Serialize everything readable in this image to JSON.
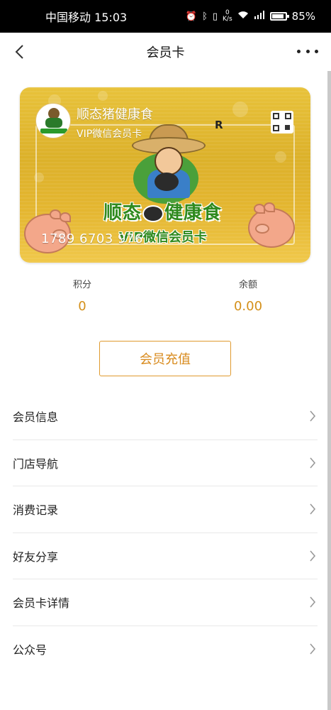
{
  "status_bar": {
    "carrier_time": "中国移动 15:03",
    "net_speed_top": "0",
    "net_speed_bottom": "K/s",
    "battery": "85%"
  },
  "nav": {
    "title": "会员卡"
  },
  "card": {
    "store_name": "顺态猪健康食",
    "card_type": "VIP微信会员卡",
    "r_mark": "R",
    "brand_left": "顺态",
    "brand_right": "健康食",
    "vip_label": "VIP微信会员卡",
    "card_number": "1789 6703 976"
  },
  "stats": {
    "points_label": "积分",
    "points_value": "0",
    "balance_label": "余额",
    "balance_value": "0.00"
  },
  "recharge_button": "会员充值",
  "menu": [
    {
      "label": "会员信息"
    },
    {
      "label": "门店导航"
    },
    {
      "label": "消费记录"
    },
    {
      "label": "好友分享"
    },
    {
      "label": "会员卡详情"
    },
    {
      "label": "公众号"
    }
  ],
  "colors": {
    "accent": "#d88a1c",
    "card_gold": "#dcb12a",
    "brand_green": "#2f8a1e"
  }
}
